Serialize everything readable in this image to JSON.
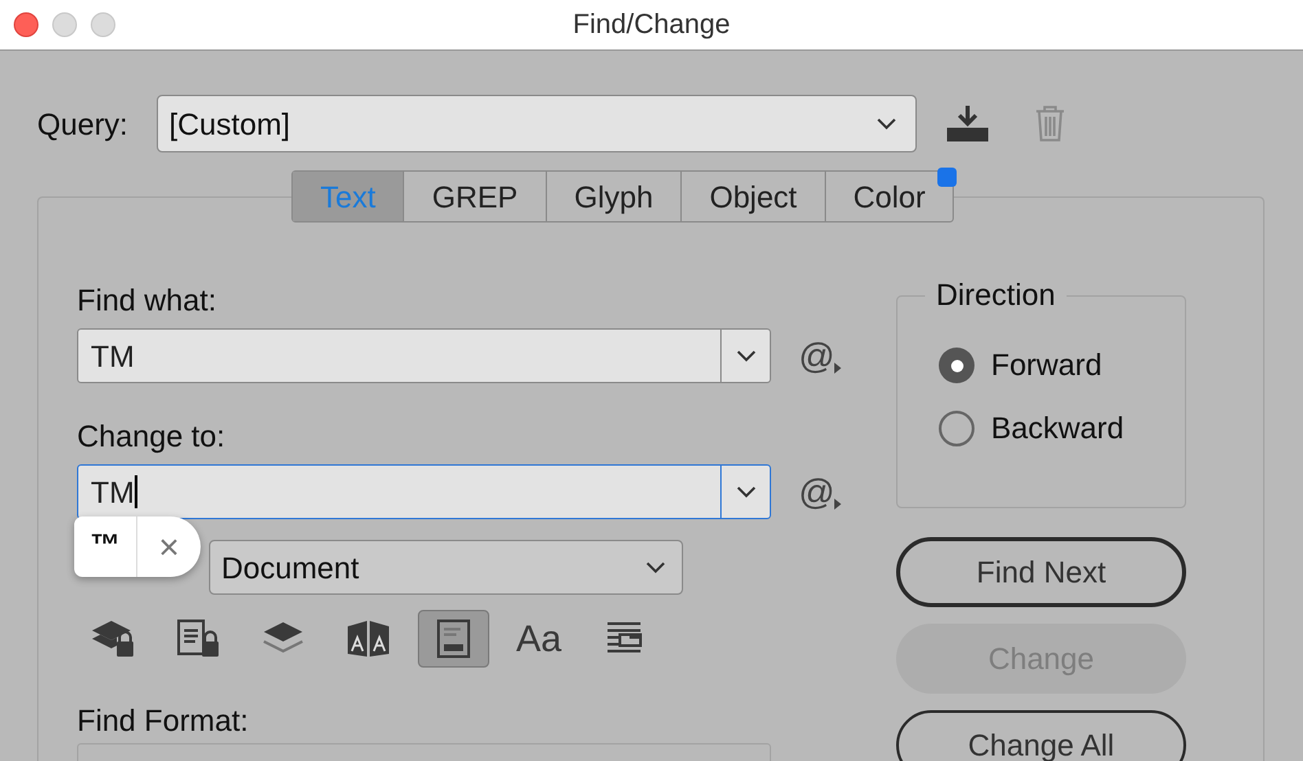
{
  "window": {
    "title": "Find/Change"
  },
  "query": {
    "label": "Query:",
    "value": "[Custom]"
  },
  "tabs": [
    {
      "label": "Text",
      "selected": true,
      "badge": false
    },
    {
      "label": "GREP",
      "selected": false,
      "badge": false
    },
    {
      "label": "Glyph",
      "selected": false,
      "badge": false
    },
    {
      "label": "Object",
      "selected": false,
      "badge": false
    },
    {
      "label": "Color",
      "selected": false,
      "badge": true
    }
  ],
  "find_what": {
    "label": "Find what:",
    "value": "TM",
    "focused": false,
    "special_button": "@"
  },
  "change_to": {
    "label": "Change to:",
    "value": "TM",
    "focused": true,
    "special_button": "@"
  },
  "suggestion_popup": {
    "symbol": "™",
    "close": "×"
  },
  "search": {
    "value": "Document"
  },
  "options": [
    {
      "kind": "locked-layers",
      "selected": false
    },
    {
      "kind": "locked-stories",
      "selected": false
    },
    {
      "kind": "hidden-layers",
      "selected": false
    },
    {
      "kind": "master-pages",
      "selected": false
    },
    {
      "kind": "footnotes",
      "selected": true
    },
    {
      "kind": "case",
      "label": "Aa",
      "selected": false
    },
    {
      "kind": "whole-word",
      "selected": false
    }
  ],
  "find_format": {
    "label": "Find Format:"
  },
  "direction": {
    "title": "Direction",
    "options": [
      {
        "label": "Forward",
        "selected": true
      },
      {
        "label": "Backward",
        "selected": false
      }
    ]
  },
  "buttons": [
    {
      "label": "Find Next",
      "default": true,
      "disabled": false
    },
    {
      "label": "Change",
      "default": false,
      "disabled": true
    },
    {
      "label": "Change All",
      "default": false,
      "disabled": false
    }
  ]
}
